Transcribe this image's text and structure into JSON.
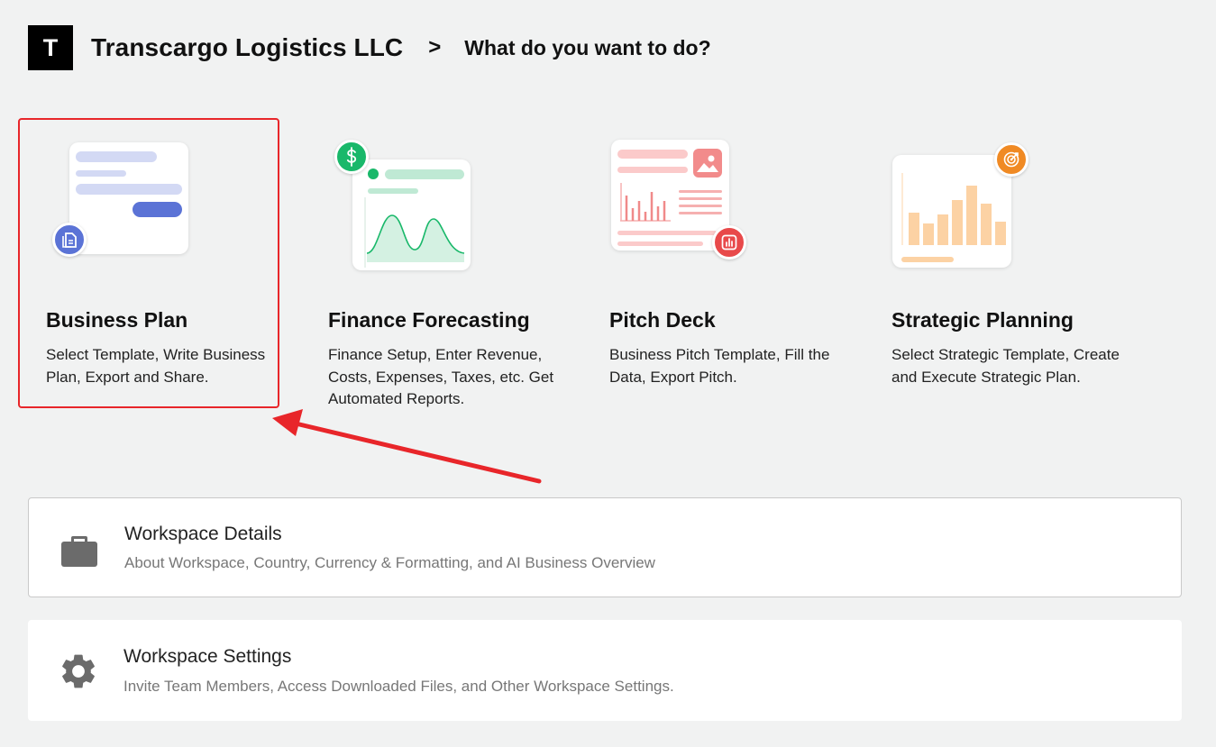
{
  "header": {
    "logo_letter": "T",
    "company_name": "Transcargo Logistics LLC",
    "separator": ">",
    "prompt": "What do you want to do?"
  },
  "cards": [
    {
      "title": "Business Plan",
      "description": "Select Template, Write Business Plan, Export and Share.",
      "icon": "document-icon",
      "accent": "#5b73d6"
    },
    {
      "title": "Finance Forecasting",
      "description": "Finance Setup, Enter Revenue, Costs, Expenses, Taxes, etc. Get Automated Reports.",
      "icon": "dollar-icon",
      "accent": "#19b86a"
    },
    {
      "title": "Pitch Deck",
      "description": "Business Pitch Template, Fill the Data, Export Pitch.",
      "icon": "chart-icon",
      "accent": "#e8494a"
    },
    {
      "title": "Strategic Planning",
      "description": "Select Strategic Template, Create and Execute Strategic Plan.",
      "icon": "target-icon",
      "accent": "#f08a24"
    }
  ],
  "panels": {
    "details": {
      "title": "Workspace Details",
      "description": "About Workspace, Country, Currency & Formatting, and AI Business Overview",
      "icon": "briefcase-icon"
    },
    "settings": {
      "title": "Workspace Settings",
      "description": "Invite Team Members, Access Downloaded Files, and Other Workspace Settings.",
      "icon": "gear-icon"
    }
  },
  "annotation": {
    "highlight_color": "#e8262a"
  }
}
